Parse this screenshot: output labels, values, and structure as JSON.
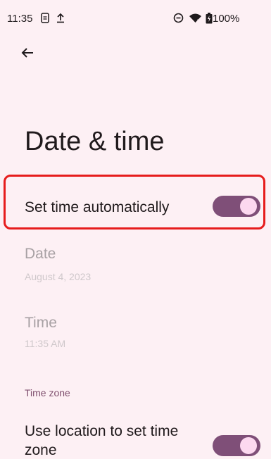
{
  "status_bar": {
    "time": "11:35",
    "battery": "100%",
    "icons": [
      "sim-icon",
      "upload-icon",
      "dnd-icon",
      "wifi-icon",
      "battery-icon"
    ]
  },
  "header": {
    "back_icon": "arrow-back-icon",
    "title": "Date & time"
  },
  "settings": {
    "auto_time": {
      "title": "Set time automatically",
      "enabled": true
    },
    "date": {
      "title": "Date",
      "summary": "August 4, 2023"
    },
    "time": {
      "title": "Time",
      "summary": "11:35 AM"
    },
    "time_zone_section": "Time zone",
    "location_tz": {
      "title_line1": "Use location to set time",
      "title_line2": "zone",
      "enabled": true
    }
  },
  "colors": {
    "background": "#fdf0f4",
    "toggle_track": "#7f4f78",
    "toggle_thumb": "#fcd8ef",
    "highlight": "#e61c1c",
    "section_header": "#7f4f6e"
  }
}
